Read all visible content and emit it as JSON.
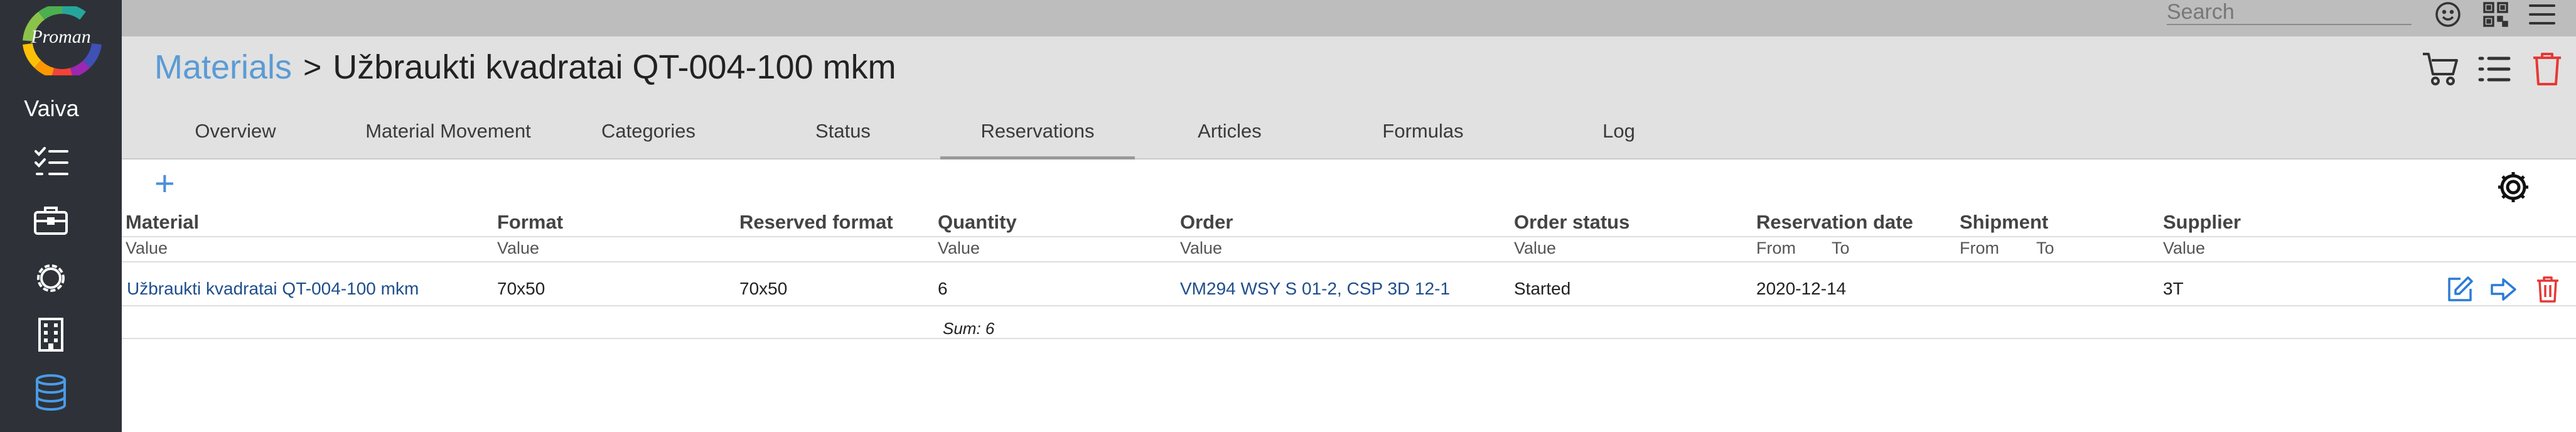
{
  "sidebar": {
    "logo_text": "Proman",
    "user_name": "Vaiva",
    "icons": [
      "tasks-icon",
      "briefcase-icon",
      "gear-outline-icon",
      "building-icon",
      "database-icon"
    ]
  },
  "topbar": {
    "search_placeholder": "Search",
    "icons": [
      "smiley-icon",
      "qr-code-icon",
      "hamburger-menu-icon"
    ]
  },
  "header": {
    "breadcrumb_link": "Materials",
    "breadcrumb_separator": ">",
    "title": "Užbraukti kvadratai QT-004-100 mkm",
    "icons": [
      "cart-icon",
      "list-icon",
      "trash-icon"
    ]
  },
  "tabs": [
    {
      "label": "Overview",
      "active": false
    },
    {
      "label": "Material Movement",
      "active": false
    },
    {
      "label": "Categories",
      "active": false
    },
    {
      "label": "Status",
      "active": false
    },
    {
      "label": "Reservations",
      "active": true
    },
    {
      "label": "Articles",
      "active": false
    },
    {
      "label": "Formulas",
      "active": false
    },
    {
      "label": "Log",
      "active": false
    }
  ],
  "toolbar": {
    "add_label": "+"
  },
  "table": {
    "columns": [
      {
        "label": "Material",
        "filter": "Value"
      },
      {
        "label": "Format",
        "filter": "Value"
      },
      {
        "label": "Reserved format",
        "filter": ""
      },
      {
        "label": "Quantity",
        "filter": "Value"
      },
      {
        "label": "Order",
        "filter": "Value"
      },
      {
        "label": "Order status",
        "filter": "Value"
      },
      {
        "label": "Reservation date",
        "filter_from": "From",
        "filter_to": "To"
      },
      {
        "label": "Shipment",
        "filter_from": "From",
        "filter_to": "To"
      },
      {
        "label": "Supplier",
        "filter": "Value"
      }
    ],
    "rows": [
      {
        "material": "Užbraukti kvadratai QT-004-100 mkm",
        "format": "70x50",
        "reserved_format": "70x50",
        "quantity": "6",
        "order": "VM294 WSY S 01-2, CSP 3D 12-1",
        "order_status": "Started",
        "reservation_date": "2020-12-14",
        "shipment": "",
        "supplier": "3T"
      }
    ],
    "sum_label": "Sum: 6"
  },
  "colors": {
    "sidebar_bg": "#2e3238",
    "topbar_bg": "#bdbdbd",
    "header_bg": "#e1e1e1",
    "link": "#5b9bd5",
    "accent_blue": "#4a8fd8",
    "danger": "#e53935"
  }
}
